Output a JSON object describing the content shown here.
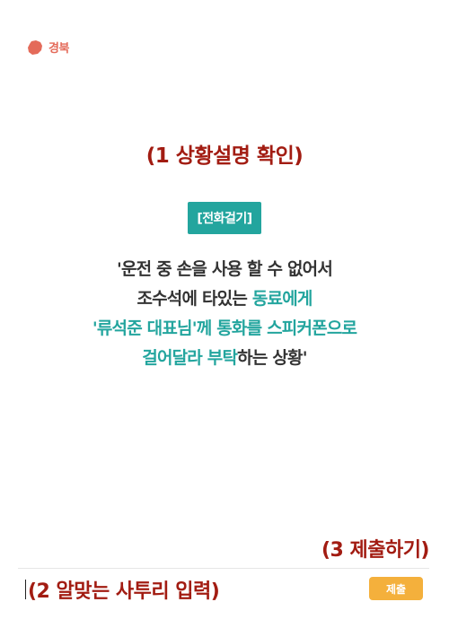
{
  "region": {
    "label": "경북",
    "icon": "map-region-icon",
    "color": "#e46b5a"
  },
  "step1": {
    "text": "(1 상황설명 확인)"
  },
  "scenario": {
    "badge": "[전화걸기]",
    "line1": "'운전 중 손을 사용 할 수 없어서",
    "line2_a": "조수석에 타있는 ",
    "line2_b": "동료에게",
    "line3_a": "'류석준 대표님'",
    "line3_b": "께 통화를 스피커폰으로",
    "line4_a": "걸어달라 부탁",
    "line4_b": "하는 상황'"
  },
  "step3": {
    "text": "(3 제출하기)"
  },
  "input": {
    "annotation": "(2 알맞는 사투리 입력)",
    "value": ""
  },
  "submit": {
    "label": "제출"
  },
  "colors": {
    "accent_red": "#a21c12",
    "teal": "#23a59e",
    "submit": "#f4b03c",
    "body_text": "#333333"
  }
}
